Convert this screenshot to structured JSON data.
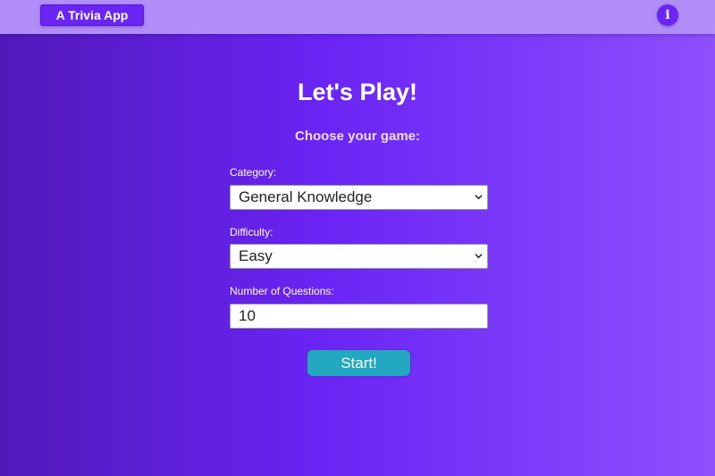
{
  "header": {
    "app_title": "A Trivia App",
    "info_icon_glyph": "i"
  },
  "main": {
    "title": "Let's Play!",
    "subtitle": "Choose your game:",
    "category": {
      "label": "Category:",
      "value": "General Knowledge"
    },
    "difficulty": {
      "label": "Difficulty:",
      "value": "Easy"
    },
    "questions": {
      "label": "Number of Questions:",
      "value": "10"
    },
    "start_label": "Start!"
  },
  "icons": {
    "info": "info-icon",
    "dropdown": "chevron-down-icon"
  },
  "colors": {
    "header_bg": "#b18df8",
    "brand_button": "#6a24f4",
    "start_button": "#22a8c0",
    "gradient_start": "#5119b9",
    "gradient_end": "#8e50fc"
  }
}
